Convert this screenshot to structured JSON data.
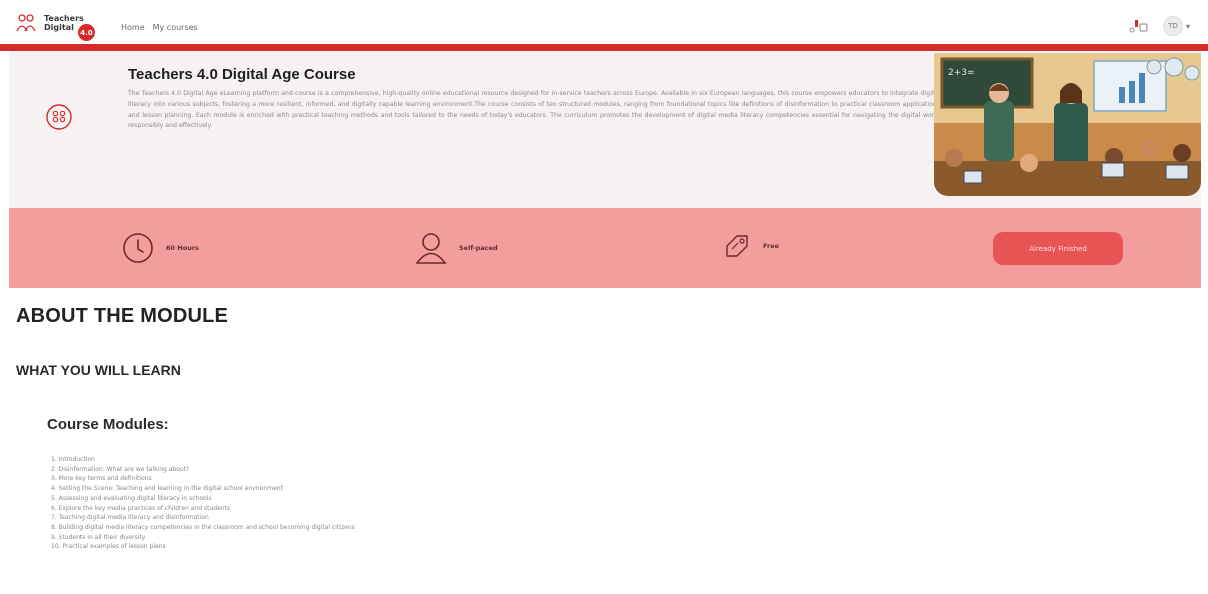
{
  "nav": {
    "logo_line1": "Teachers",
    "logo_line2": "Digital",
    "logo_badge": "4.0",
    "links": [
      "Home",
      "My courses"
    ],
    "user_initials": "TD",
    "caret": "▾"
  },
  "hero": {
    "title": "Teachers 4.0 Digital Age Course",
    "description": "The Teachers 4.0 Digital Age eLearning platform and course is a comprehensive, high-quality online educational resource designed for in-service teachers across Europe. Available in six European languages, this course empowers educators to integrate digital literacy into various subjects, fostering a more resilient, informed, and digitally capable learning environment.The course consists of ten structured modules, ranging from foundational topics like definitions of disinformation to practical classroom applications and lesson planning. Each module is enriched with practical teaching methods and tools tailored to the needs of today's educators. The curriculum promotes the development of digital media literacy competencies essential for navigating the digital world responsibly and effectively."
  },
  "stats": {
    "duration": "60 Hours",
    "pace": "Self-paced",
    "price": "Free",
    "status_button": "Already Finished"
  },
  "about": {
    "heading": "ABOUT THE MODULE",
    "subheading": "WHAT YOU WILL LEARN",
    "modules_heading": "Course Modules:",
    "modules": [
      "1. Introduction",
      "2. Disinformation: What are we talking about?",
      "3. More key terms and definitions",
      "4. Setting the Scene: Teaching and learning in the digital school environment",
      "5. Assessing and evaluating digital literacy in schools",
      "6. Explore the key media practices of children and students",
      "7. Teaching digital media literacy and disinformation",
      "8. Building digital media literacy competencies in the classroom and school becoming digital citizens",
      "9. Students in all their diversity",
      "10. Practical examples of lesson plans"
    ]
  },
  "colors": {
    "brand_red": "#d62b2b",
    "band_pink": "#f49d9d",
    "button_red": "#e85454",
    "hero_bg": "#f6f2f1"
  }
}
